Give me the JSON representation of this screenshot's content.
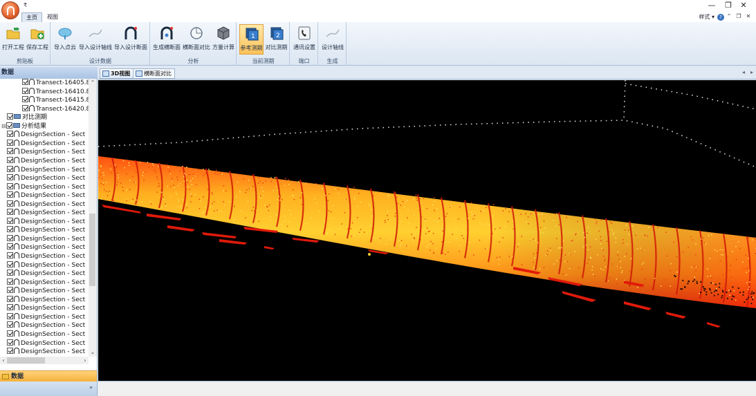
{
  "window": {
    "quick_access": "₹",
    "minimize": "—",
    "restore": "❐",
    "close": "✕"
  },
  "tabs": [
    {
      "label": "主页",
      "active": true
    },
    {
      "label": "视图",
      "active": false
    }
  ],
  "style_menu": "样式 ▾",
  "help_label": "?",
  "ribbon": {
    "groups": [
      {
        "label": "剪贴板",
        "buttons": [
          "打开工程",
          "保存工程"
        ]
      },
      {
        "label": "设计数据",
        "buttons": [
          "导入点云",
          "导入设计轴线",
          "导入设计断面"
        ]
      },
      {
        "label": "分析",
        "buttons": [
          "生成横断面",
          "横断面对比",
          "方量计算"
        ]
      },
      {
        "label": "当前测期",
        "buttons": [
          "参考测期",
          "对比测期"
        ]
      },
      {
        "label": "端口",
        "buttons": [
          "通讯设置"
        ]
      },
      {
        "label": "生成",
        "buttons": [
          "设计轴线"
        ]
      }
    ],
    "pressed_button": "参考测期"
  },
  "left_panel": {
    "title": "数据",
    "tree": [
      {
        "label": "Transect-16405.8!",
        "level": 2,
        "type": "section"
      },
      {
        "label": "Transect-16410.8!",
        "level": 2,
        "type": "section"
      },
      {
        "label": "Transect-16415.8!",
        "level": 2,
        "type": "section"
      },
      {
        "label": "Transect-16420.8!",
        "level": 2,
        "type": "section"
      },
      {
        "label": "对比测期",
        "level": 1,
        "type": "folder"
      },
      {
        "label": "分析结果",
        "level": 0,
        "type": "folder-expand"
      },
      {
        "label": "DesignSection - Sect",
        "level": 1,
        "type": "section"
      },
      {
        "label": "DesignSection - Sect",
        "level": 1,
        "type": "section"
      },
      {
        "label": "DesignSection - Sect",
        "level": 1,
        "type": "section"
      },
      {
        "label": "DesignSection - Sect",
        "level": 1,
        "type": "section"
      },
      {
        "label": "DesignSection - Sect",
        "level": 1,
        "type": "section"
      },
      {
        "label": "DesignSection - Sect",
        "level": 1,
        "type": "section"
      },
      {
        "label": "DesignSection - Sect",
        "level": 1,
        "type": "section"
      },
      {
        "label": "DesignSection - Sect",
        "level": 1,
        "type": "section"
      },
      {
        "label": "DesignSection - Sect",
        "level": 1,
        "type": "section"
      },
      {
        "label": "DesignSection - Sect",
        "level": 1,
        "type": "section"
      },
      {
        "label": "DesignSection - Sect",
        "level": 1,
        "type": "section"
      },
      {
        "label": "DesignSection - Sect",
        "level": 1,
        "type": "section"
      },
      {
        "label": "DesignSection - Sect",
        "level": 1,
        "type": "section"
      },
      {
        "label": "DesignSection - Sect",
        "level": 1,
        "type": "section"
      },
      {
        "label": "DesignSection - Sect",
        "level": 1,
        "type": "section"
      },
      {
        "label": "DesignSection - Sect",
        "level": 1,
        "type": "section"
      },
      {
        "label": "DesignSection - Sect",
        "level": 1,
        "type": "section"
      },
      {
        "label": "DesignSection - Sect",
        "level": 1,
        "type": "section"
      },
      {
        "label": "DesignSection - Sect",
        "level": 1,
        "type": "section"
      },
      {
        "label": "DesignSection - Sect",
        "level": 1,
        "type": "section"
      },
      {
        "label": "DesignSection - Sect",
        "level": 1,
        "type": "section"
      },
      {
        "label": "DesignSection - Sect",
        "level": 1,
        "type": "section"
      },
      {
        "label": "DesignSection - Sect",
        "level": 1,
        "type": "section"
      },
      {
        "label": "DesignSection - Sect",
        "level": 1,
        "type": "section"
      },
      {
        "label": "DesignSection - Sect",
        "level": 1,
        "type": "section"
      },
      {
        "label": "DesignSection - Sect",
        "level": 1,
        "type": "section"
      },
      {
        "label": "DesignSection - Sect",
        "level": 1,
        "type": "section"
      }
    ],
    "bottom_tab": "数据",
    "more_label": "»"
  },
  "doc_tabs": [
    {
      "label": "3D视图",
      "active": true
    },
    {
      "label": "横断面对比",
      "active": false
    }
  ],
  "colors": {
    "ribbon_bg": "#dbe6f2",
    "pressed": "#fbc25a",
    "pointcloud_hot": "#ffe040",
    "pointcloud_cold": "#e02010"
  }
}
